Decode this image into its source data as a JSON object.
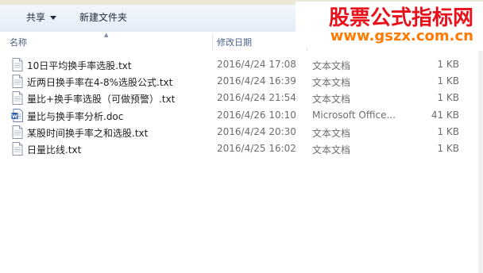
{
  "toolbar": {
    "share_label": "共享",
    "new_folder_label": "新建文件夹"
  },
  "columns": {
    "name": "名称",
    "date": "修改日期"
  },
  "watermark": {
    "title": "股票公式指标网",
    "url": "www.gszx.com.cn"
  },
  "files": [
    {
      "name": "10日平均换手率选股.txt",
      "date": "2016/4/24 17:08",
      "type": "文本文档",
      "size": "1 KB",
      "icon": "text-file-icon"
    },
    {
      "name": "近两日换手率在4-8%选股公式.txt",
      "date": "2016/4/24 16:39",
      "type": "文本文档",
      "size": "1 KB",
      "icon": "text-file-icon"
    },
    {
      "name": "量比+换手率选股（可做预警）.txt",
      "date": "2016/4/24 21:54",
      "type": "文本文档",
      "size": "1 KB",
      "icon": "text-file-icon"
    },
    {
      "name": "量比与换手率分析.doc",
      "date": "2016/4/26 10:10",
      "type": "Microsoft Office...",
      "size": "41 KB",
      "icon": "word-doc-icon"
    },
    {
      "name": "某股时间换手率之和选股.txt",
      "date": "2016/4/24 20:30",
      "type": "文本文档",
      "size": "1 KB",
      "icon": "text-file-icon"
    },
    {
      "name": "日量比线.txt",
      "date": "2016/4/25 16:02",
      "type": "文本文档",
      "size": "1 KB",
      "icon": "text-file-icon"
    }
  ]
}
